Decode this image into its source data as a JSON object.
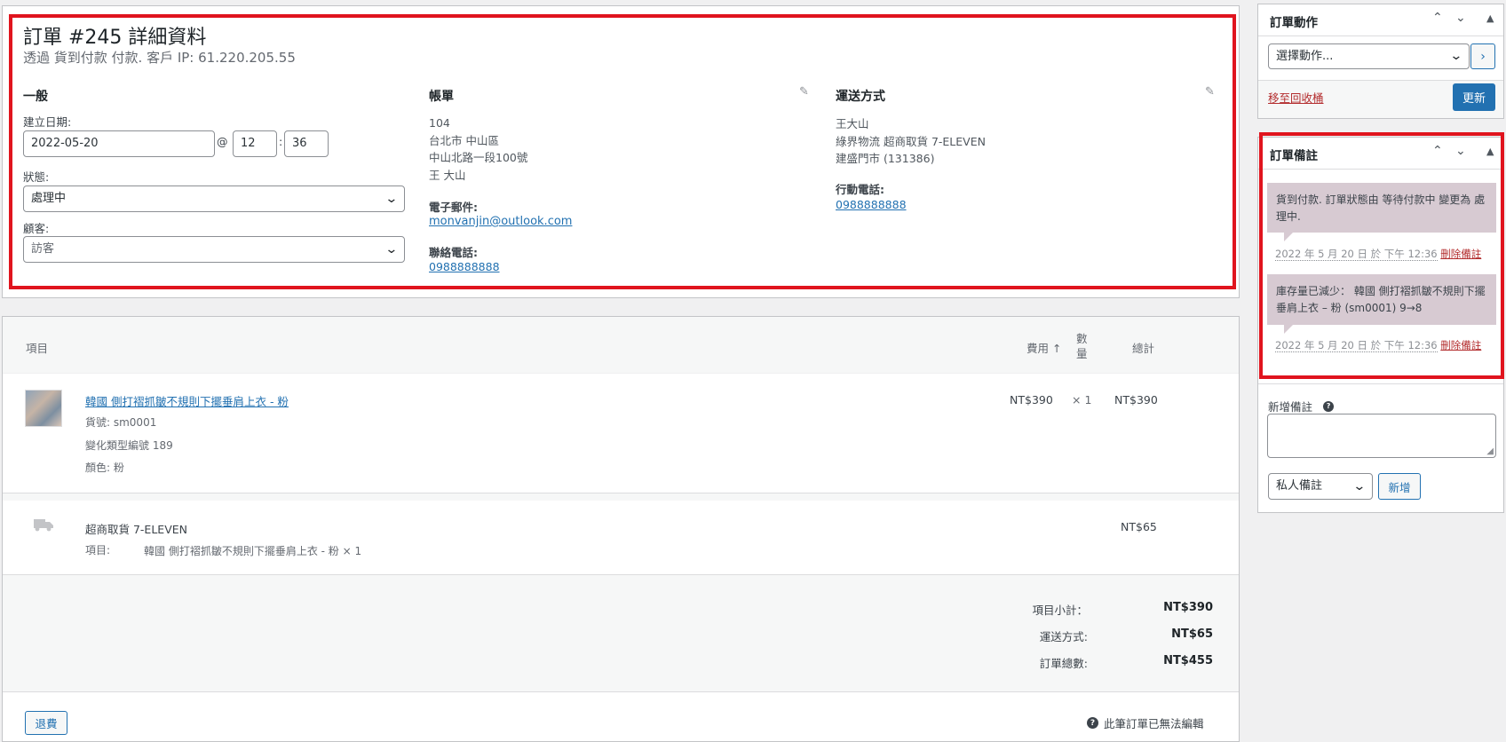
{
  "order": {
    "title": "訂單 #245 詳細資料",
    "subtitle": "透過 貨到付款 付款. 客戶 IP: 61.220.205.55",
    "general": {
      "heading": "一般",
      "date_label": "建立日期:",
      "date_value": "2022-05-20",
      "at": "@",
      "hour": "12",
      "colon": ":",
      "minute": "36",
      "status_label": "狀態:",
      "status_value": "處理中",
      "customer_label": "顧客:",
      "customer_value": "訪客"
    },
    "billing": {
      "heading": "帳單",
      "address": [
        "104",
        "台北市 中山區",
        "中山北路一段100號",
        "王 大山"
      ],
      "email_label": "電子郵件:",
      "email": "monvanjin@outlook.com",
      "phone_label": "聯絡電話:",
      "phone": "0988888888"
    },
    "shipping": {
      "heading": "運送方式",
      "address": [
        "王大山",
        "綠界物流 超商取貨 7-ELEVEN",
        "建盛門市 (131386)"
      ],
      "mobile_label": "行動電話:",
      "mobile": "0988888888"
    }
  },
  "items": {
    "headers": {
      "item": "項目",
      "cost": "費用",
      "sort_icon": "arrow-up",
      "qty_line1": "數",
      "qty_line2": "量",
      "total": "總計"
    },
    "product": {
      "name": "韓國 側打褶抓皺不規則下擺垂肩上衣 - 粉",
      "sku": "貨號: sm0001",
      "variation": "變化類型編號 189",
      "color": "顏色: 粉",
      "cost": "NT$390",
      "qty": "× 1",
      "total": "NT$390"
    },
    "shipping_line": {
      "name": "超商取貨 7-ELEVEN",
      "items_label": "項目:",
      "items_value": "韓國 側打褶抓皺不規則下擺垂肩上衣 - 粉 × 1",
      "total": "NT$65"
    },
    "totals": {
      "subtotal_label": "項目小計：",
      "subtotal": "NT$390",
      "shipping_label": "運送方式:",
      "shipping": "NT$65",
      "order_total_label": "訂單總數:",
      "order_total": "NT$455"
    },
    "refund_button": "退費",
    "not_editable": "此筆訂單已無法編輯"
  },
  "actions_box": {
    "title": "訂單動作",
    "select_placeholder": "選擇動作...",
    "trash_link": "移至回收桶",
    "update_button": "更新"
  },
  "notes_box": {
    "title": "訂單備註",
    "notes": [
      {
        "text": "貨到付款. 訂單狀態由 等待付款中 變更為 處理中.",
        "date": "2022 年 5 月 20 日 於 下午 12:36",
        "delete": "刪除備註"
      },
      {
        "text": "庫存量已減少： 韓國 側打褶抓皺不規則下擺垂肩上衣 – 粉 (sm0001) 9→8",
        "date": "2022 年 5 月 20 日 於 下午 12:36",
        "delete": "刪除備註"
      }
    ],
    "add_note_label": "新增備註",
    "note_type": "私人備註",
    "add_button": "新增"
  },
  "colors": {
    "highlight": "#e0141e",
    "primary": "#2271b1",
    "note_bg": "#d7cad2",
    "delete_link": "#b32d2e"
  }
}
